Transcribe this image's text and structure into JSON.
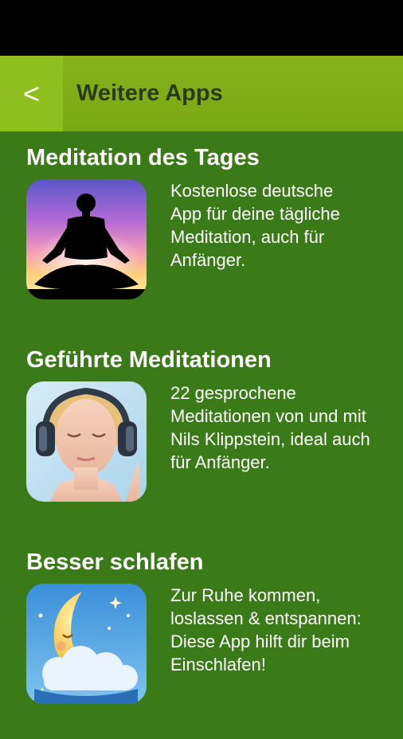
{
  "header": {
    "back_label": "<",
    "title": "Weitere Apps"
  },
  "apps": [
    {
      "name": "Meditation des Tages",
      "description": "Kostenlose deutsche\nApp für deine tägliche\nMeditation, auch für\nAnfänger.",
      "icon": "meditation-silhouette-icon"
    },
    {
      "name": "Geführte Meditationen",
      "description": "22 gesprochene\nMeditationen von und mit\nNils Klippstein, ideal auch\nfür Anfänger.",
      "icon": "woman-headphones-icon"
    },
    {
      "name": "Besser schlafen",
      "description": "Zur Ruhe kommen,\nloslassen & entspannen:\nDiese App hilft dir beim\nEinschlafen!",
      "icon": "sleeping-moon-icon"
    }
  ],
  "colors": {
    "background": "#3b7a18",
    "appbar": "#7aa814",
    "back_button": "#8fbf1f",
    "title_text": "#2b3a18"
  }
}
